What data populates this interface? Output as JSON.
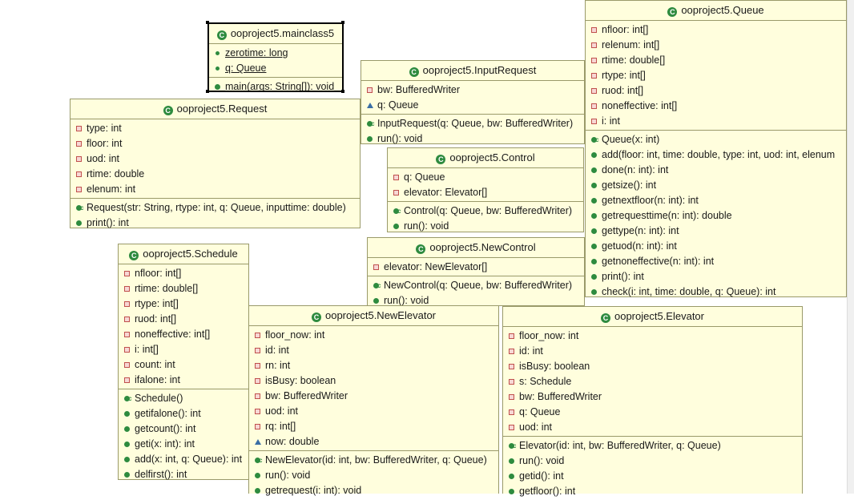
{
  "classes": {
    "mainclass5": {
      "name": "ooproject5.mainclass5",
      "fields": [
        "zerotime: long",
        "q: Queue"
      ],
      "methods": [
        "main(args: String[]): void"
      ]
    },
    "inputrequest": {
      "name": "ooproject5.InputRequest",
      "fields": [
        "bw: BufferedWriter",
        "q: Queue"
      ],
      "methods": [
        "InputRequest(q: Queue, bw: BufferedWriter)",
        "run(): void"
      ]
    },
    "queue": {
      "name": "ooproject5.Queue",
      "fields": [
        "nfloor: int[]",
        "relenum: int[]",
        "rtime: double[]",
        "rtype: int[]",
        "ruod: int[]",
        "noneffective: int[]",
        "i: int"
      ],
      "methods": [
        "Queue(x: int)",
        "add(floor: int, time: double, type: int, uod: int, elenum",
        "done(n: int): int",
        "getsize(): int",
        "getnextfloor(n: int): int",
        "getrequesttime(n: int): double",
        "gettype(n: int): int",
        "getuod(n: int): int",
        "getnoneffective(n: int): int",
        "print(): int",
        "check(i: int, time: double, q: Queue): int"
      ]
    },
    "request": {
      "name": "ooproject5.Request",
      "fields": [
        "type: int",
        "floor: int",
        "uod: int",
        "rtime: double",
        "elenum: int"
      ],
      "methods": [
        "Request(str: String, rtype: int, q: Queue, inputtime: double)",
        "print(): int"
      ]
    },
    "control": {
      "name": "ooproject5.Control",
      "fields": [
        "q: Queue",
        "elevator: Elevator[]"
      ],
      "methods": [
        "Control(q: Queue, bw: BufferedWriter)",
        "run(): void"
      ]
    },
    "newcontrol": {
      "name": "ooproject5.NewControl",
      "fields": [
        "elevator: NewElevator[]"
      ],
      "methods": [
        "NewControl(q: Queue, bw: BufferedWriter)",
        "run(): void"
      ]
    },
    "schedule": {
      "name": "ooproject5.Schedule",
      "fields": [
        "nfloor: int[]",
        "rtime: double[]",
        "rtype: int[]",
        "ruod: int[]",
        "noneffective: int[]",
        "i: int[]",
        "count: int",
        "ifalone: int"
      ],
      "methods": [
        "Schedule()",
        "getifalone(): int",
        "getcount(): int",
        "geti(x: int): int",
        "add(x: int, q: Queue): int",
        "delfirst(): int"
      ]
    },
    "newelevator": {
      "name": "ooproject5.NewElevator",
      "fields": [
        "floor_now: int",
        "id: int",
        "rn: int",
        "isBusy: boolean",
        "bw: BufferedWriter",
        "uod: int",
        "rq: int[]",
        "now: double"
      ],
      "methods": [
        "NewElevator(id: int, bw: BufferedWriter, q: Queue)",
        "run(): void",
        "getrequest(i: int): void"
      ]
    },
    "elevator": {
      "name": "ooproject5.Elevator",
      "fields": [
        "floor_now: int",
        "id: int",
        "isBusy: boolean",
        "s: Schedule",
        "bw: BufferedWriter",
        "q: Queue",
        "uod: int"
      ],
      "methods": [
        "Elevator(id: int, bw: BufferedWriter, q: Queue)",
        "run(): void",
        "getid(): int",
        "getfloor(): int"
      ]
    }
  }
}
